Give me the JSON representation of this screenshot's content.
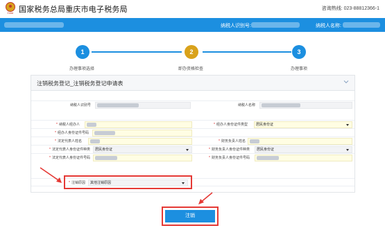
{
  "header": {
    "logo_text": "Σstar",
    "title": "国家税务总局重庆市电子税务局",
    "hotline": "咨询热线: 023-88812366-1"
  },
  "userbar": {
    "taxpayer_id_label": "纳税人识别号:",
    "taxpayer_name_label": "纳税人名称:"
  },
  "steps": [
    {
      "number": "1",
      "label": "办理事项选择",
      "color": "#1c8fe0"
    },
    {
      "number": "2",
      "label": "即办资格检查",
      "color": "#d9a21b"
    },
    {
      "number": "3",
      "label": "办理事项",
      "color": "#1c8fe0"
    }
  ],
  "form": {
    "title": "注销税务登记_注销税务登记申请表",
    "taxpayer_id_label": "纳税人识别号",
    "taxpayer_name_label": "纳税人名称",
    "agent_label": "纳税人经办人",
    "agent_id_type_label": "经办人身份证件类型",
    "agent_id_type_value": "居民身份证",
    "agent_id_no_label": "经办人身份证件号码",
    "legal_rep_name_label": "法定代表人姓名",
    "finance_head_name_label": "财务负责人姓名",
    "legal_rep_id_type_label": "法定代表人身份证件种类",
    "legal_rep_id_type_value": "居民身份证",
    "finance_head_id_type_label": "财务负责人身份证件种类",
    "finance_head_id_type_value": "居民身份证",
    "legal_rep_id_no_label": "法定代表人身份证件号码",
    "finance_head_id_no_label": "财务负责人身份证件号码",
    "cancel_reason_label": "注销原因",
    "cancel_reason_value": "其他注销原因"
  },
  "submit_label": "注销",
  "colors": {
    "accent": "#1c8fe0",
    "step2": "#d9a21b",
    "highlight": "#e53935",
    "required": "#e02020",
    "input_bg": "#fffde3"
  }
}
